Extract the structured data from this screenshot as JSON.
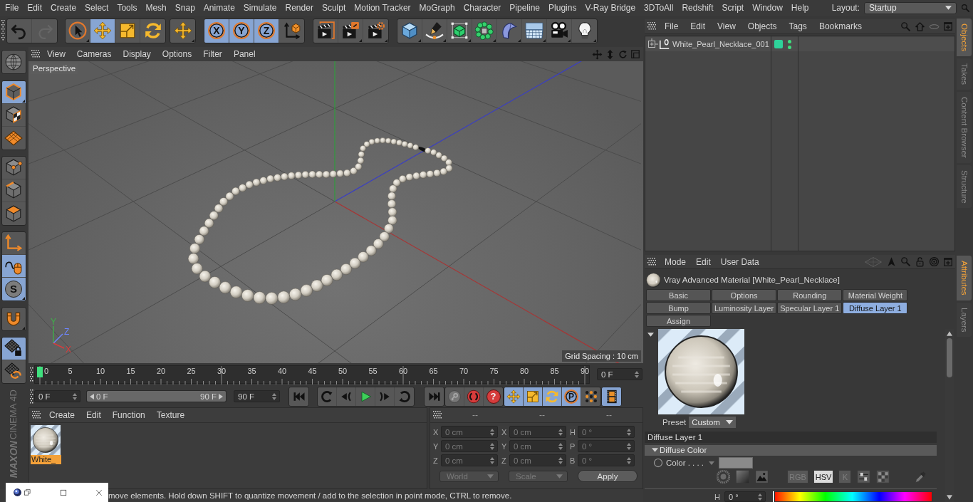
{
  "menu_bar": {
    "items": [
      "File",
      "Edit",
      "Create",
      "Select",
      "Tools",
      "Mesh",
      "Snap",
      "Animate",
      "Simulate",
      "Render",
      "Sculpt",
      "Motion Tracker",
      "MoGraph",
      "Character",
      "Pipeline",
      "Plugins",
      "V-Ray Bridge",
      "3DToAll",
      "Redshift",
      "Script",
      "Window",
      "Help"
    ],
    "layout_label": "Layout:",
    "layout": "Startup"
  },
  "main_toolbar": [
    [
      {
        "selected": false,
        "disabled": false
      },
      {
        "selected": false,
        "disabled": true
      }
    ],
    [
      {
        "selected": false,
        "disabled": false
      },
      {
        "selected": true,
        "disabled": false
      },
      {
        "selected": false,
        "disabled": false
      },
      {
        "selected": false,
        "disabled": false
      }
    ],
    [
      {
        "selected": false,
        "disabled": false
      }
    ],
    [
      {
        "label": "X",
        "selected": true,
        "disabled": false
      },
      {
        "label": "Y",
        "selected": true,
        "disabled": false
      },
      {
        "label": "Z",
        "selected": true,
        "disabled": false
      },
      {
        "selected": false,
        "disabled": false
      }
    ],
    [
      {
        "selected": false,
        "disabled": false
      },
      {
        "selected": false,
        "disabled": false
      },
      {
        "selected": false,
        "disabled": false
      }
    ],
    [
      {
        "selected": false,
        "disabled": false
      },
      {
        "selected": false,
        "disabled": false
      },
      {
        "selected": false,
        "disabled": false
      },
      {
        "selected": false,
        "disabled": false
      },
      {
        "selected": false,
        "disabled": false
      },
      {
        "selected": false,
        "disabled": false
      },
      {
        "selected": false,
        "disabled": false
      },
      {
        "selected": false,
        "disabled": false
      }
    ]
  ],
  "left_toolbar": [
    [
      {
        "selected": false
      }
    ],
    [
      {
        "selected": true
      },
      {
        "selected": false
      },
      {
        "selected": false
      }
    ],
    [
      {
        "selected": false
      },
      {
        "selected": false
      },
      {
        "selected": false
      }
    ],
    [
      {
        "selected": false
      },
      {
        "selected": true
      },
      {
        "label": "S",
        "selected": true
      }
    ],
    [
      {
        "selected": false
      }
    ],
    [
      {
        "selected": true
      },
      {
        "selected": false
      }
    ]
  ],
  "logo": [
    "MAXON",
    "CINEMA 4D"
  ],
  "viewport": {
    "menu": [
      "View",
      "Cameras",
      "Display",
      "Options",
      "Filter",
      "Panel"
    ],
    "camera": "Perspective",
    "axes": [
      {
        "label": "Y",
        "color": "#3fae4a"
      },
      {
        "label": "Z",
        "color": "#6f86ff"
      },
      {
        "label": "X",
        "color": "#d83c3c"
      }
    ],
    "grid_spacing": "Grid Spacing : 10 cm"
  },
  "timeline": {
    "frames": [
      "0",
      "5",
      "10",
      "15",
      "20",
      "25",
      "30",
      "35",
      "40",
      "45",
      "50",
      "55",
      "60",
      "65",
      "70",
      "75",
      "80",
      "85",
      "90"
    ],
    "level": 0,
    "current_frame": "0 F"
  },
  "transport": {
    "start": "0 F",
    "range": {
      "start": "0 F",
      "end": "90 F",
      "level": 1
    },
    "end": "90 F",
    "buttons": [
      [
        {
          "selected": false
        }
      ],
      [
        {
          "selected": false
        },
        {
          "selected": false
        },
        {
          "selected": false
        },
        {
          "selected": false
        },
        {
          "selected": false
        }
      ],
      [
        {
          "selected": false
        }
      ],
      [
        {
          "selected": false
        },
        {
          "selected": false
        },
        {
          "label": "?",
          "selected": false
        }
      ],
      [
        {
          "selected": true
        },
        {
          "selected": true
        },
        {
          "selected": true
        },
        {
          "label": "P",
          "selected": true
        },
        {
          "selected": false
        }
      ],
      [
        {
          "selected": true
        }
      ]
    ]
  },
  "materials": {
    "menu": [
      "Create",
      "Edit",
      "Function",
      "Texture"
    ],
    "items": [
      {
        "name": "White_",
        "selected": true
      }
    ]
  },
  "coordinates": {
    "disabled": true,
    "columns": [
      {
        "header": "--",
        "fields": [
          {
            "label": "X",
            "value": "0 cm"
          },
          {
            "label": "Y",
            "value": "0 cm"
          },
          {
            "label": "Z",
            "value": "0 cm"
          }
        ]
      },
      {
        "header": "--",
        "fields": [
          {
            "label": "X",
            "value": "0 cm"
          },
          {
            "label": "Y",
            "value": "0 cm"
          },
          {
            "label": "Z",
            "value": "0 cm"
          }
        ]
      },
      {
        "header": "--",
        "fields": [
          {
            "label": "H",
            "value": "0 °"
          },
          {
            "label": "P",
            "value": "0 °"
          },
          {
            "label": "B",
            "value": "0 °"
          }
        ]
      }
    ],
    "space": "World",
    "transform": "Scale",
    "apply": "Apply"
  },
  "status_bar": {
    "text": "move elements. Hold down SHIFT to quantize movement / add to the selection in point mode, CTRL to remove."
  },
  "object_manager": {
    "menu": [
      "File",
      "Edit",
      "View",
      "Objects",
      "Tags",
      "Bookmarks"
    ],
    "objects": [
      {
        "name": "White_Pearl_Necklace_001",
        "expanded": false,
        "color": "#2ed39a",
        "visible_in_editor": true,
        "visible_in_renderer": true
      }
    ]
  },
  "object_tabs": [
    {
      "label": "Objects",
      "selected": true
    },
    {
      "label": "Takes",
      "selected": false
    },
    {
      "label": "Content Browser",
      "selected": false
    },
    {
      "label": "Structure",
      "selected": false
    }
  ],
  "attributes": {
    "menu": [
      "Mode",
      "Edit",
      "User Data"
    ],
    "title": "Vray Advanced Material [White_Pearl_Necklace]",
    "tabs": [
      {
        "label": "Basic",
        "selected": false
      },
      {
        "label": "Options",
        "selected": false
      },
      {
        "label": "Rounding",
        "selected": false
      },
      {
        "label": "Material Weight",
        "selected": false
      },
      {
        "label": "Bump",
        "selected": false
      },
      {
        "label": "Luminosity Layer",
        "selected": false
      },
      {
        "label": "Specular Layer 1",
        "selected": false
      },
      {
        "label": "Diffuse Layer 1",
        "selected": true
      },
      {
        "label": "Assign",
        "selected": false
      }
    ],
    "preview_expanded": true,
    "preset_label": "Preset",
    "preset": "Custom",
    "section": "Diffuse Layer 1",
    "group": {
      "label": "Diffuse Color",
      "expanded": true
    },
    "color_label": "Color . . . .",
    "color_modes": [
      {
        "label": "RGB",
        "selected": false
      },
      {
        "label": "HSV",
        "selected": true
      },
      {
        "label": "K",
        "selected": false
      }
    ],
    "hue": {
      "label": "H",
      "value": "0 °",
      "level": 0
    }
  },
  "attribute_tabs": [
    {
      "label": "Attributes",
      "selected": true
    },
    {
      "label": "Layers",
      "selected": false
    }
  ]
}
